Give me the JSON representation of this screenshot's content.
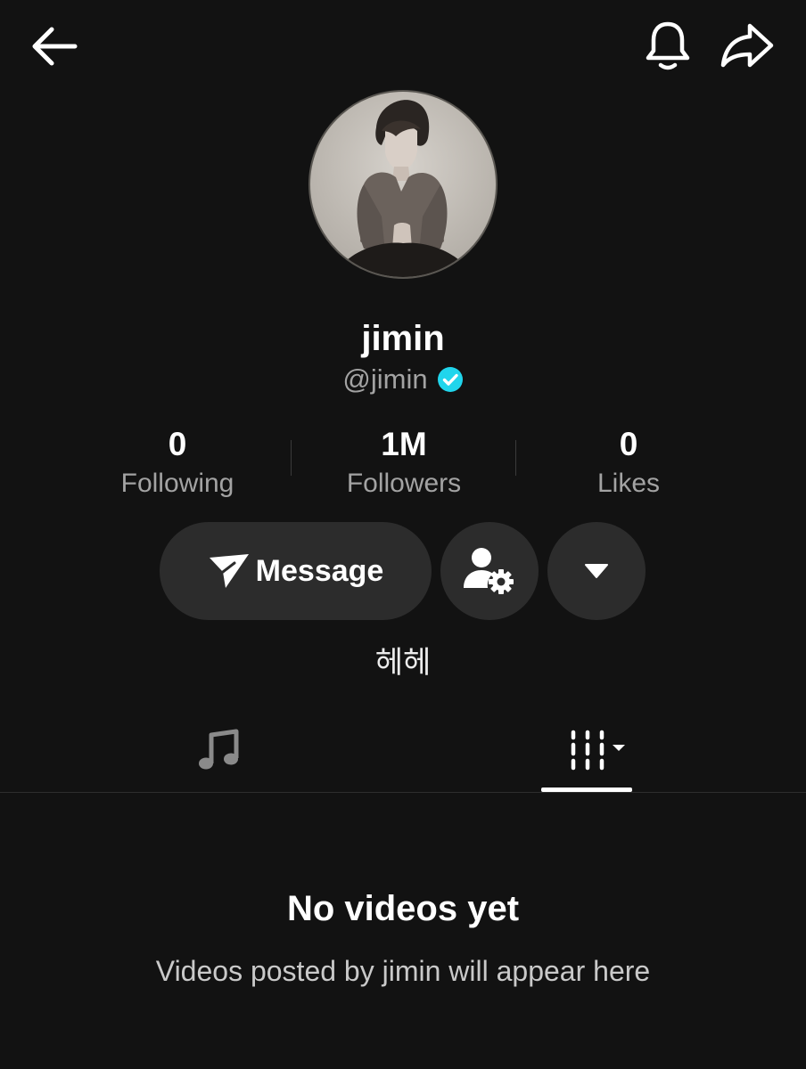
{
  "header": {
    "back_icon": "back-arrow-icon",
    "notification_icon": "bell-icon",
    "share_icon": "share-icon"
  },
  "profile": {
    "display_name": "jimin",
    "handle": "@jimin",
    "verified": true,
    "verified_color": "#20D5EC",
    "bio": "헤헤"
  },
  "stats": [
    {
      "value": "0",
      "label": "Following"
    },
    {
      "value": "1M",
      "label": "Followers"
    },
    {
      "value": "0",
      "label": "Likes"
    }
  ],
  "actions": {
    "message_label": "Message",
    "message_icon": "send-icon",
    "profile_settings_icon": "user-settings-icon",
    "more_icon": "caret-down-icon"
  },
  "tabs": [
    {
      "icon": "music-note-icon",
      "active": false
    },
    {
      "icon": "videos-grid-icon",
      "active": true
    }
  ],
  "empty_state": {
    "title": "No videos yet",
    "subtitle": "Videos posted by jimin will appear here"
  }
}
